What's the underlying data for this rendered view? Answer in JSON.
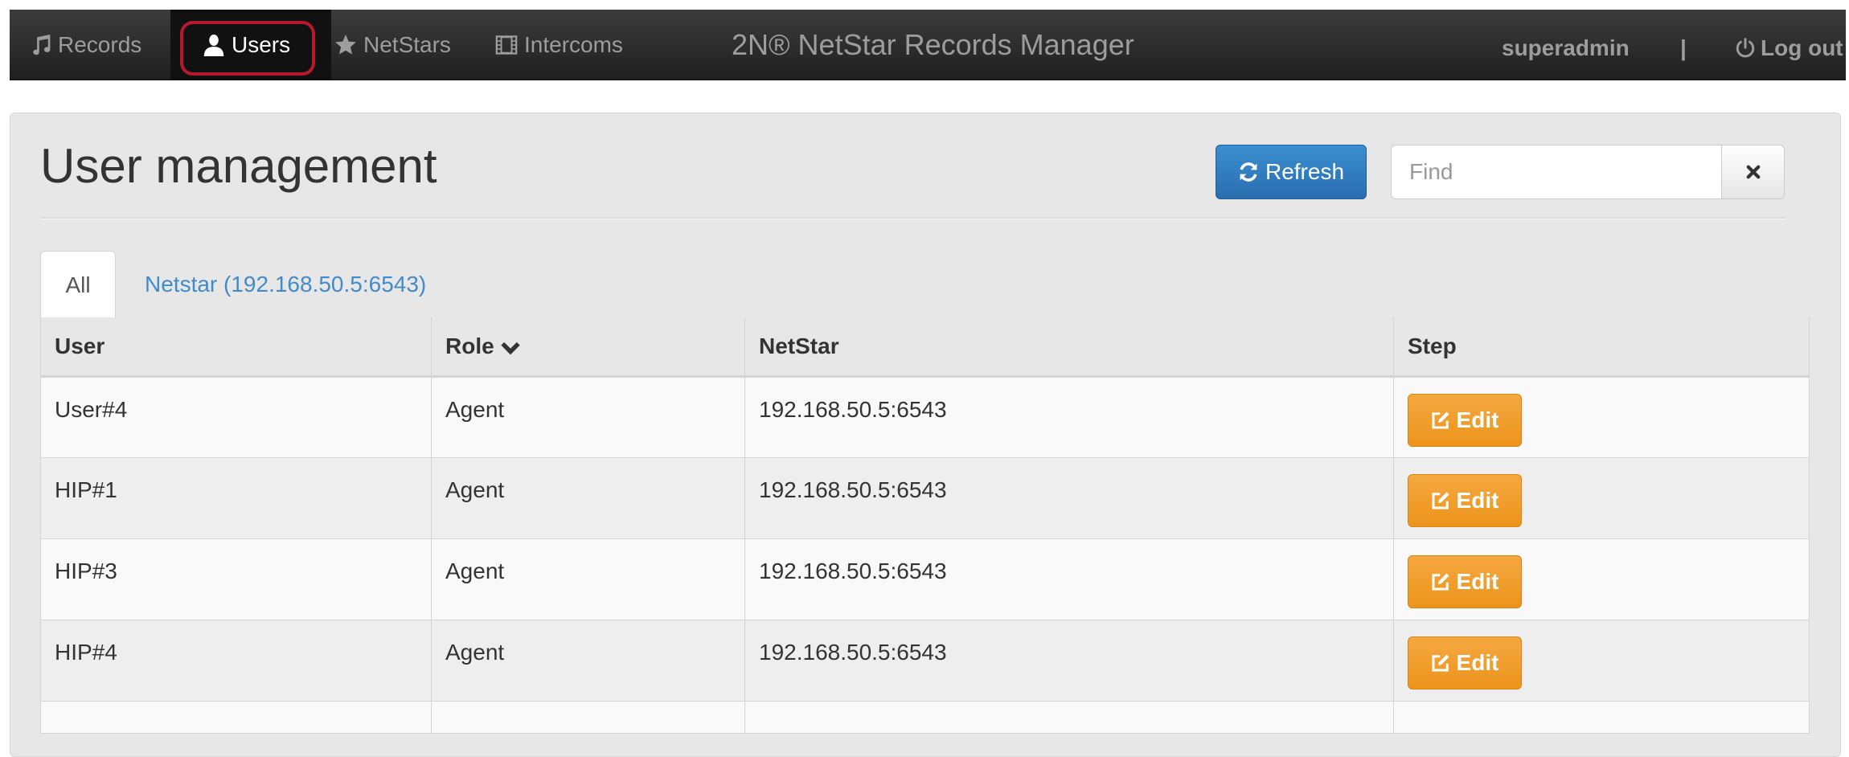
{
  "navbar": {
    "items": [
      {
        "label": "Records",
        "icon": "music-icon"
      },
      {
        "label": "Users",
        "icon": "user-icon"
      },
      {
        "label": "NetStars",
        "icon": "star-icon"
      },
      {
        "label": "Intercoms",
        "icon": "film-icon"
      }
    ],
    "active_item": "Users",
    "brand": "2N® NetStar Records Manager",
    "username": "superadmin",
    "separator": "|",
    "logout_label": "Log out"
  },
  "page": {
    "title": "User management",
    "refresh_label": "Refresh",
    "search": {
      "placeholder": "Find",
      "value": ""
    }
  },
  "tabs": [
    {
      "label": "All",
      "active": true
    },
    {
      "label": "Netstar (192.168.50.5:6543)",
      "active": false
    }
  ],
  "table": {
    "headers": [
      "User",
      "Role",
      "NetStar",
      "Step"
    ],
    "sorted_column": "Role",
    "edit_label": "Edit",
    "rows": [
      {
        "user": "User#4",
        "role": "Agent",
        "netstar": "192.168.50.5:6543"
      },
      {
        "user": "HIP#1",
        "role": "Agent",
        "netstar": "192.168.50.5:6543"
      },
      {
        "user": "HIP#3",
        "role": "Agent",
        "netstar": "192.168.50.5:6543"
      },
      {
        "user": "HIP#4",
        "role": "Agent",
        "netstar": "192.168.50.5:6543"
      }
    ]
  },
  "colors": {
    "navbar": "#2b2b2b",
    "primary": "#2a6db0",
    "warning": "#ec941c",
    "highlight": "#b8182c",
    "link": "#428bca"
  }
}
